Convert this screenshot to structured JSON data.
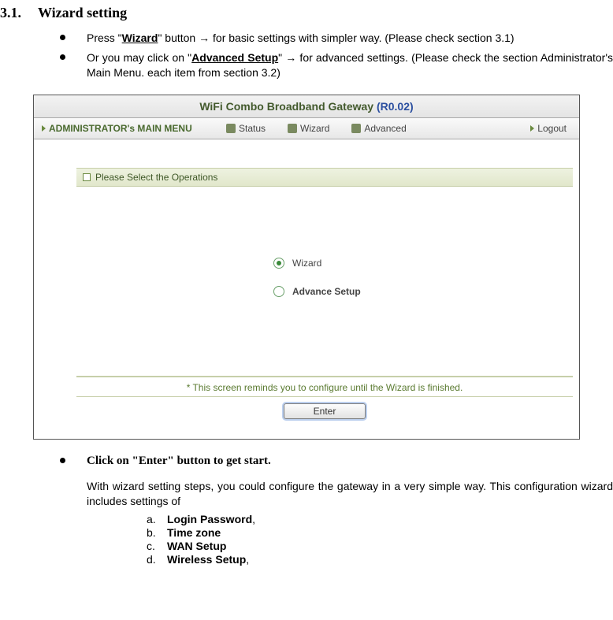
{
  "heading": {
    "number": "3.1.",
    "title": "Wizard setting"
  },
  "bullets": [
    {
      "pre": "Press \"",
      "bold": "Wizard",
      "mid": "\" button ",
      "arrow": "→",
      "post": " for basic settings with simpler way. (Please check section 3.1)"
    },
    {
      "pre": "Or you may click on \"",
      "bold": "Advanced Setup",
      "mid": "\" ",
      "arrow": "→",
      "post": " for advanced settings. (Please check the section Administrator's Main Menu.  each item from section 3.2)"
    }
  ],
  "shot": {
    "title_main": "WiFi Combo Broadband Gateway ",
    "title_ver": "(R0.02)",
    "menu_admin": "ADMINISTRATOR's MAIN MENU",
    "menu_status": "Status",
    "menu_wizard": "Wizard",
    "menu_advanced": "Advanced",
    "menu_logout": "Logout",
    "ops_header": "Please Select the Operations",
    "opt_wizard": "Wizard",
    "opt_advance": "Advance Setup",
    "remind": "* This screen reminds you to configure until the Wizard is finished.",
    "enter": "Enter"
  },
  "post_bullet": "Click on \"Enter\" button to get start.",
  "paragraph": "With wizard setting steps, you could configure the gateway in a very simple way. This configuration wizard includes settings of",
  "sublist": [
    {
      "letter": "a.",
      "label": "Login Password",
      "suffix": ","
    },
    {
      "letter": "b.",
      "label": "Time zone",
      "suffix": ""
    },
    {
      "letter": "c.",
      "label": "WAN Setup",
      "suffix": ""
    },
    {
      "letter": "d.",
      "label": "Wireless Setup",
      "suffix": ","
    }
  ]
}
